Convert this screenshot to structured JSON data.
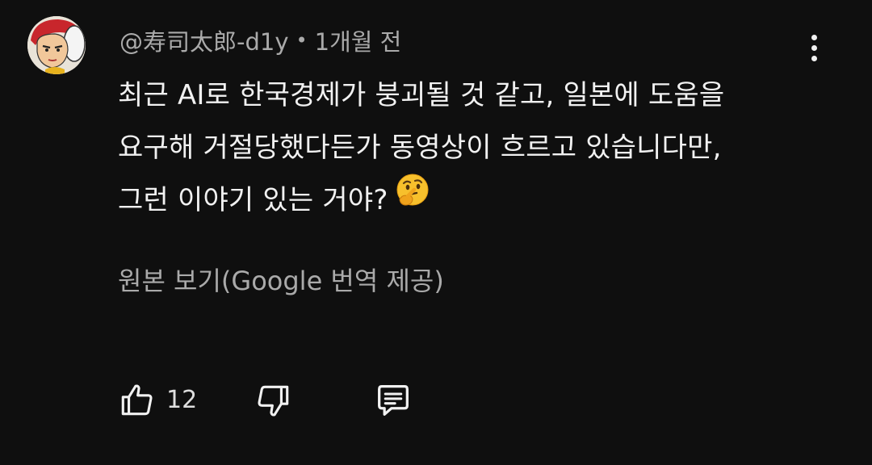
{
  "comment": {
    "author": "@寿司太郎-d1y",
    "separator": "•",
    "time": "1개월 전",
    "text_lines": [
      "최근 AI로 한국경제가 붕괴될 것 같고, 일본에 도움을",
      "요구해 거절당했다든가 동영상이 흐르고 있습니다만,",
      "그런 이야기 있는 거야?"
    ],
    "emoji": "thinking-face",
    "translate_link": "원본 보기(Google 번역 제공)",
    "like_count": "12"
  },
  "icons": {
    "more": "vertical-ellipsis-icon",
    "like": "thumbs-up-icon",
    "dislike": "thumbs-down-icon",
    "reply": "reply-comment-icon"
  },
  "colors": {
    "background": "#0f0f0f",
    "text_primary": "#f1f1f1",
    "text_secondary": "#aaaaaa"
  }
}
